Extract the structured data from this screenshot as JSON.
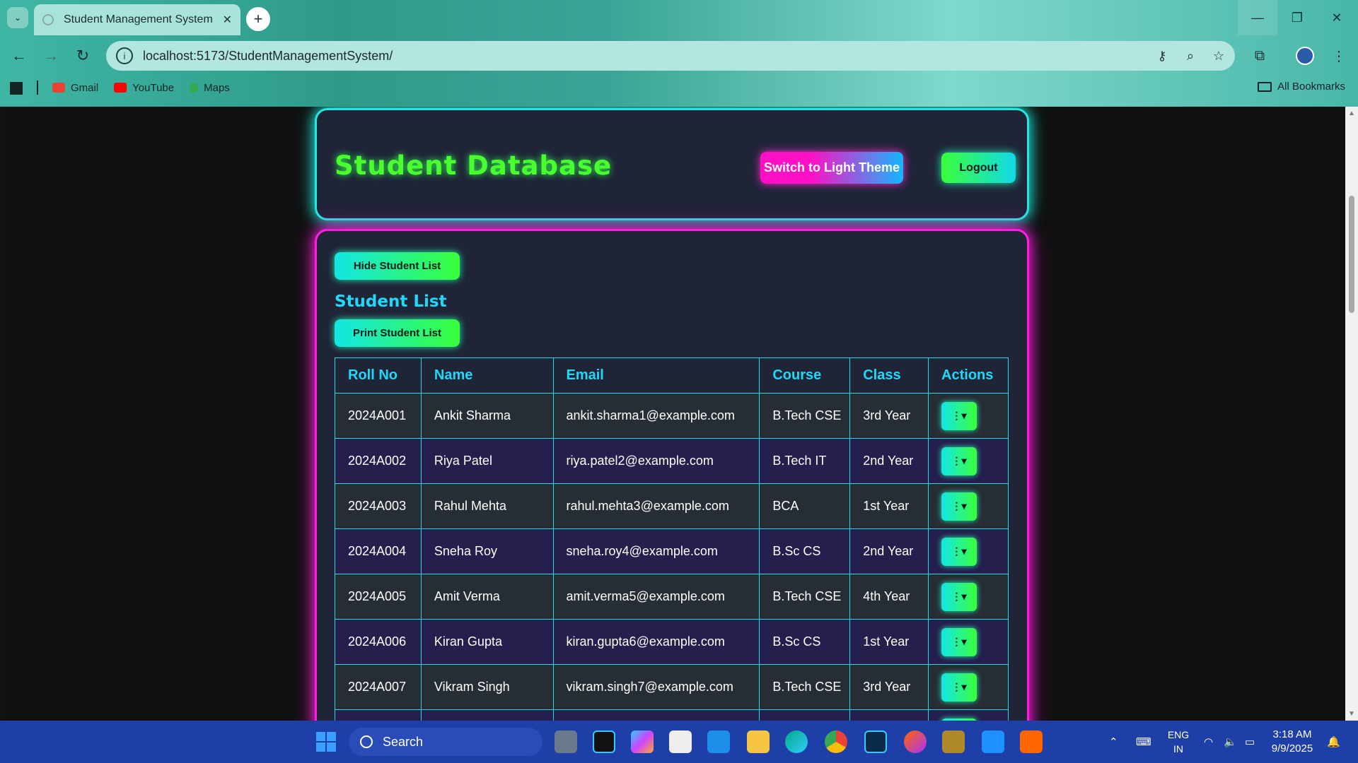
{
  "browser": {
    "tab_title": "Student Management System",
    "url": "localhost:5173/StudentManagementSystem/",
    "bookmarks": [
      {
        "label": "Gmail",
        "color": "#ea4335"
      },
      {
        "label": "YouTube",
        "color": "#ff0000"
      },
      {
        "label": "Maps",
        "color": "#34a853"
      }
    ],
    "all_bookmarks_label": "All Bookmarks"
  },
  "header": {
    "title": "Student Database",
    "theme_button_label": "Switch to Light Theme",
    "logout_button_label": "Logout"
  },
  "list": {
    "hide_button_label": "Hide Student List",
    "heading": "Student List",
    "print_button_label": "Print Student List",
    "columns": [
      "Roll No",
      "Name",
      "Email",
      "Course",
      "Class",
      "Actions"
    ],
    "rows": [
      {
        "roll": "2024A001",
        "name": "Ankit Sharma",
        "email": "ankit.sharma1@example.com",
        "course": "B.Tech CSE",
        "class": "3rd Year"
      },
      {
        "roll": "2024A002",
        "name": "Riya Patel",
        "email": "riya.patel2@example.com",
        "course": "B.Tech IT",
        "class": "2nd Year"
      },
      {
        "roll": "2024A003",
        "name": "Rahul Mehta",
        "email": "rahul.mehta3@example.com",
        "course": "BCA",
        "class": "1st Year"
      },
      {
        "roll": "2024A004",
        "name": "Sneha Roy",
        "email": "sneha.roy4@example.com",
        "course": "B.Sc CS",
        "class": "2nd Year"
      },
      {
        "roll": "2024A005",
        "name": "Amit Verma",
        "email": "amit.verma5@example.com",
        "course": "B.Tech CSE",
        "class": "4th Year"
      },
      {
        "roll": "2024A006",
        "name": "Kiran Gupta",
        "email": "kiran.gupta6@example.com",
        "course": "B.Sc CS",
        "class": "1st Year"
      },
      {
        "roll": "2024A007",
        "name": "Vikram Singh",
        "email": "vikram.singh7@example.com",
        "course": "B.Tech CSE",
        "class": "3rd Year"
      },
      {
        "roll": "",
        "name": "",
        "email": "",
        "course": "",
        "class": ""
      }
    ],
    "action_glyph": "⋮▾"
  },
  "taskbar": {
    "search_placeholder": "Search",
    "lang_top": "ENG",
    "lang_bottom": "IN",
    "time": "3:18 AM",
    "date": "9/9/2025"
  },
  "colors": {
    "header_border": "#27e6e0",
    "list_border": "#ff1ee0",
    "title_green": "#4bff2f",
    "heading_cyan": "#20d8f8"
  }
}
